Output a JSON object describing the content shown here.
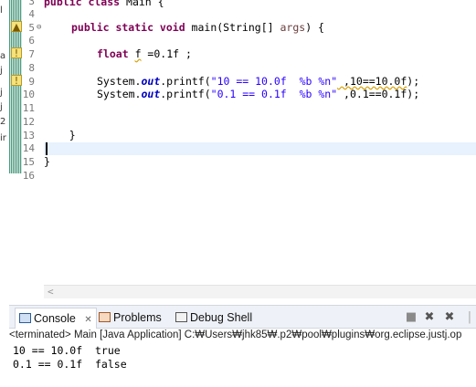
{
  "editor": {
    "lines": [
      {
        "num": "3",
        "text": "public class Main {"
      },
      {
        "num": "4",
        "text": ""
      },
      {
        "num": "5",
        "text": "    public static void main(String[] args) {"
      },
      {
        "num": "6",
        "text": ""
      },
      {
        "num": "7",
        "text": "        float f =0.1f ;"
      },
      {
        "num": "8",
        "text": ""
      },
      {
        "num": "9",
        "text": "        System.out.printf(\"10 == 10.0f  %b %n\" ,10==10.0f);"
      },
      {
        "num": "10",
        "text": "        System.out.printf(\"0.1 == 0.1f  %b %n\" ,0.1==0.1f);"
      },
      {
        "num": "11",
        "text": ""
      },
      {
        "num": "12",
        "text": ""
      },
      {
        "num": "13",
        "text": "    }"
      },
      {
        "num": "14",
        "text": ""
      },
      {
        "num": "15",
        "text": "}"
      },
      {
        "num": "16",
        "text": ""
      }
    ],
    "code": {
      "l3_kw": "public class",
      "l3_rest": " Main {",
      "l5_kw": "public static void",
      "l5_rest": " main(String[] ",
      "l5_args": "args",
      "l5_end": ") {",
      "l7_kw": "float",
      "l7_var": "f",
      "l7_rest": " =0.1f ;",
      "sysout_prefix": "System.",
      "sysout_field": "out",
      "printf": ".printf(",
      "l9_str": "\"10 == 10.0f  %b %n\"",
      "l9_arg": " ,10==10.0f",
      "l9_end": ");",
      "l10_str": "\"0.1 == 0.1f  %b %n\"",
      "l10_arg": " ,0.1==0.1f",
      "l10_end": ");",
      "l13": "    }",
      "l15": "}"
    },
    "fold_glyph": "⊖",
    "left_strip_letters": [
      "l",
      "",
      "",
      "a",
      "j",
      "j",
      "j",
      "2",
      "ir"
    ]
  },
  "console": {
    "tabs": [
      {
        "label": "Console",
        "close": "✕",
        "icon": "console-icon"
      },
      {
        "label": "Problems",
        "icon": "problems-icon"
      },
      {
        "label": "Debug Shell",
        "icon": "debug-shell-icon"
      }
    ],
    "status": "<terminated> Main [Java Application] C:₩Users₩jhk85₩.p2₩pool₩plugins₩org.eclipse.justj.op",
    "output": [
      "10 == 10.0f  true",
      "0.1 == 0.1f  false"
    ],
    "toolbar_icons": [
      "terminate-icon",
      "remove-launch-icon",
      "remove-all-icon"
    ]
  },
  "colors": {
    "keyword": "#7f0055",
    "string": "#2a00ff",
    "field": "#0000c0",
    "current_line": "#e8f2fe"
  }
}
